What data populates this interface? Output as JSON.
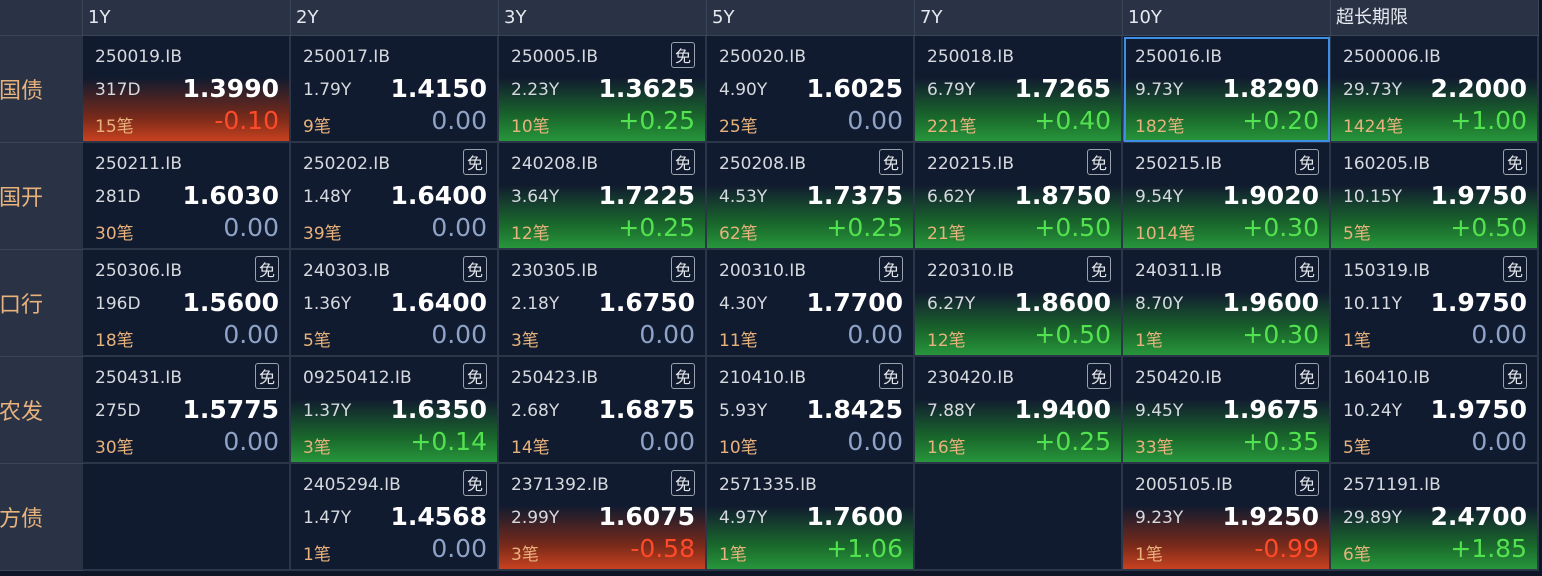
{
  "columns": [
    "1Y",
    "2Y",
    "3Y",
    "5Y",
    "7Y",
    "10Y",
    "超长期限"
  ],
  "rows": [
    {
      "label": "国债",
      "cells": [
        {
          "code": "250019.IB",
          "term": "317D",
          "yield": "1.3990",
          "trades": "15笔",
          "change": "-0.10",
          "trend": "down",
          "mian": ""
        },
        {
          "code": "250017.IB",
          "term": "1.79Y",
          "yield": "1.4150",
          "trades": "9笔",
          "change": "0.00",
          "trend": "flat",
          "mian": ""
        },
        {
          "code": "250005.IB",
          "term": "2.23Y",
          "yield": "1.3625",
          "trades": "10笔",
          "change": "+0.25",
          "trend": "up",
          "mian": "免"
        },
        {
          "code": "250020.IB",
          "term": "4.90Y",
          "yield": "1.6025",
          "trades": "25笔",
          "change": "0.00",
          "trend": "flat",
          "mian": ""
        },
        {
          "code": "250018.IB",
          "term": "6.79Y",
          "yield": "1.7265",
          "trades": "221笔",
          "change": "+0.40",
          "trend": "up",
          "mian": ""
        },
        {
          "code": "250016.IB",
          "term": "9.73Y",
          "yield": "1.8290",
          "trades": "182笔",
          "change": "+0.20",
          "trend": "up",
          "mian": "",
          "selected": true
        },
        {
          "code": "2500006.IB",
          "term": "29.73Y",
          "yield": "2.2000",
          "trades": "1424笔",
          "change": "+1.00",
          "trend": "up",
          "mian": ""
        }
      ]
    },
    {
      "label": "国开",
      "cells": [
        {
          "code": "250211.IB",
          "term": "281D",
          "yield": "1.6030",
          "trades": "30笔",
          "change": "0.00",
          "trend": "flat",
          "mian": ""
        },
        {
          "code": "250202.IB",
          "term": "1.48Y",
          "yield": "1.6400",
          "trades": "39笔",
          "change": "0.00",
          "trend": "flat",
          "mian": "免"
        },
        {
          "code": "240208.IB",
          "term": "3.64Y",
          "yield": "1.7225",
          "trades": "12笔",
          "change": "+0.25",
          "trend": "up",
          "mian": "免"
        },
        {
          "code": "250208.IB",
          "term": "4.53Y",
          "yield": "1.7375",
          "trades": "62笔",
          "change": "+0.25",
          "trend": "up",
          "mian": "免"
        },
        {
          "code": "220215.IB",
          "term": "6.62Y",
          "yield": "1.8750",
          "trades": "21笔",
          "change": "+0.50",
          "trend": "up",
          "mian": "免"
        },
        {
          "code": "250215.IB",
          "term": "9.54Y",
          "yield": "1.9020",
          "trades": "1014笔",
          "change": "+0.30",
          "trend": "up",
          "mian": "免"
        },
        {
          "code": "160205.IB",
          "term": "10.15Y",
          "yield": "1.9750",
          "trades": "5笔",
          "change": "+0.50",
          "trend": "up",
          "mian": "免"
        }
      ]
    },
    {
      "label": "口行",
      "cells": [
        {
          "code": "250306.IB",
          "term": "196D",
          "yield": "1.5600",
          "trades": "18笔",
          "change": "0.00",
          "trend": "flat",
          "mian": "免"
        },
        {
          "code": "240303.IB",
          "term": "1.36Y",
          "yield": "1.6400",
          "trades": "5笔",
          "change": "0.00",
          "trend": "flat",
          "mian": "免"
        },
        {
          "code": "230305.IB",
          "term": "2.18Y",
          "yield": "1.6750",
          "trades": "3笔",
          "change": "0.00",
          "trend": "flat",
          "mian": "免"
        },
        {
          "code": "200310.IB",
          "term": "4.30Y",
          "yield": "1.7700",
          "trades": "11笔",
          "change": "0.00",
          "trend": "flat",
          "mian": "免"
        },
        {
          "code": "220310.IB",
          "term": "6.27Y",
          "yield": "1.8600",
          "trades": "12笔",
          "change": "+0.50",
          "trend": "up",
          "mian": "免"
        },
        {
          "code": "240311.IB",
          "term": "8.70Y",
          "yield": "1.9600",
          "trades": "1笔",
          "change": "+0.30",
          "trend": "up",
          "mian": "免"
        },
        {
          "code": "150319.IB",
          "term": "10.11Y",
          "yield": "1.9750",
          "trades": "1笔",
          "change": "0.00",
          "trend": "flat",
          "mian": "免"
        }
      ]
    },
    {
      "label": "农发",
      "cells": [
        {
          "code": "250431.IB",
          "term": "275D",
          "yield": "1.5775",
          "trades": "30笔",
          "change": "0.00",
          "trend": "flat",
          "mian": "免"
        },
        {
          "code": "09250412.IB",
          "term": "1.37Y",
          "yield": "1.6350",
          "trades": "3笔",
          "change": "+0.14",
          "trend": "up",
          "mian": "免"
        },
        {
          "code": "250423.IB",
          "term": "2.68Y",
          "yield": "1.6875",
          "trades": "14笔",
          "change": "0.00",
          "trend": "flat",
          "mian": "免"
        },
        {
          "code": "210410.IB",
          "term": "5.93Y",
          "yield": "1.8425",
          "trades": "10笔",
          "change": "0.00",
          "trend": "flat",
          "mian": "免"
        },
        {
          "code": "230420.IB",
          "term": "7.88Y",
          "yield": "1.9400",
          "trades": "16笔",
          "change": "+0.25",
          "trend": "up",
          "mian": "免"
        },
        {
          "code": "250420.IB",
          "term": "9.45Y",
          "yield": "1.9675",
          "trades": "33笔",
          "change": "+0.35",
          "trend": "up",
          "mian": "免"
        },
        {
          "code": "160410.IB",
          "term": "10.24Y",
          "yield": "1.9750",
          "trades": "5笔",
          "change": "0.00",
          "trend": "flat",
          "mian": "免"
        }
      ]
    },
    {
      "label": "地方债",
      "cells": [
        {
          "empty": true
        },
        {
          "code": "2405294.IB",
          "term": "1.47Y",
          "yield": "1.4568",
          "trades": "1笔",
          "change": "0.00",
          "trend": "flat",
          "mian": "免"
        },
        {
          "code": "2371392.IB",
          "term": "2.99Y",
          "yield": "1.6075",
          "trades": "3笔",
          "change": "-0.58",
          "trend": "down",
          "mian": "免"
        },
        {
          "code": "2571335.IB",
          "term": "4.97Y",
          "yield": "1.7600",
          "trades": "1笔",
          "change": "+1.06",
          "trend": "up",
          "mian": ""
        },
        {
          "empty": true
        },
        {
          "code": "2005105.IB",
          "term": "9.23Y",
          "yield": "1.9250",
          "trades": "1笔",
          "change": "-0.99",
          "trend": "down",
          "mian": "免"
        },
        {
          "code": "2571191.IB",
          "term": "29.89Y",
          "yield": "2.4700",
          "trades": "6笔",
          "change": "+1.85",
          "trend": "up",
          "mian": ""
        }
      ]
    }
  ],
  "colors": {
    "up": "#53e24f",
    "down": "#ff4a2a",
    "flat": "#8ea3c6",
    "accent_orange": "#e8b27c",
    "selected_border": "#3f8ee6"
  }
}
